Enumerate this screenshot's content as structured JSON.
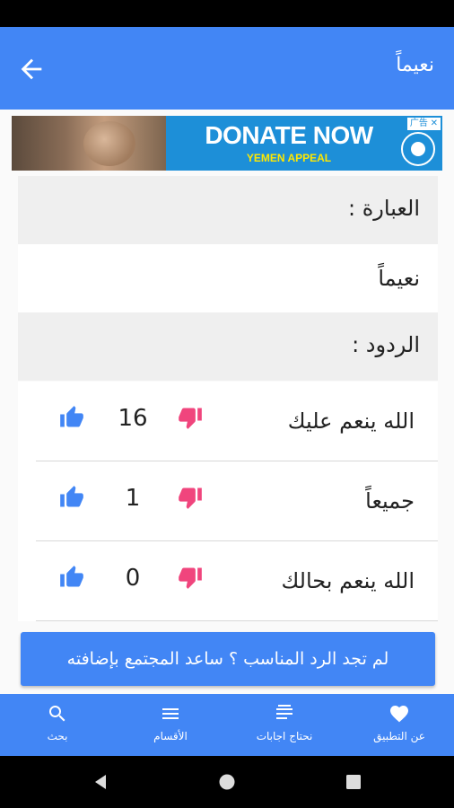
{
  "app_bar": {
    "title": "نعيماً",
    "back_icon": "arrow-back-icon"
  },
  "ad": {
    "headline": "DONATE NOW",
    "subline": "YEMEN APPEAL",
    "adchoices": "广告 ✕"
  },
  "phrase_section": {
    "header": "العبارة :",
    "value": "نعيماً"
  },
  "replies_section": {
    "header": "الردود :"
  },
  "replies": [
    {
      "text": "الله ينعم عليك",
      "count": "16"
    },
    {
      "text": "جميعاً",
      "count": "1"
    },
    {
      "text": "الله ينعم بحالك",
      "count": "0"
    }
  ],
  "cta": {
    "label": "لم تجد الرد المناسب ؟ ساعد المجتمع بإضافته"
  },
  "bottom_nav": {
    "search": "بحث",
    "sections": "الأقسام",
    "need_answers": "نحتاج اجابات",
    "about": "عن التطبيق"
  },
  "colors": {
    "primary": "#4286f5",
    "like": "#4286f5",
    "dislike": "#f0457d"
  }
}
